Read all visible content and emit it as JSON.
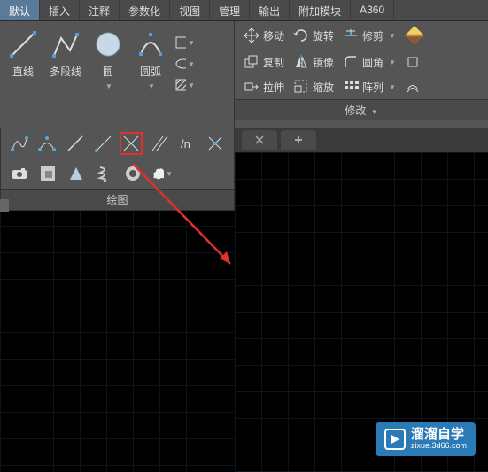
{
  "tabs": {
    "default": "默认",
    "insert": "插入",
    "annotate": "注释",
    "parametric": "参数化",
    "view": "视图",
    "manage": "管理",
    "output": "输出",
    "addons": "附加模块",
    "a360": "A360"
  },
  "draw_panel": {
    "line": "直线",
    "polyline": "多段线",
    "circle": "圆",
    "arc": "圆弧",
    "footer": "绘图"
  },
  "modify_panel": {
    "move": "移动",
    "rotate": "旋转",
    "trim": "修剪",
    "copy": "复制",
    "mirror": "镜像",
    "fillet": "圆角",
    "stretch": "拉伸",
    "scale": "缩放",
    "array": "阵列",
    "footer": "修改"
  },
  "watermark": {
    "main": "溜溜自学",
    "sub": "zixue.3d66.com"
  },
  "chart_data": null
}
